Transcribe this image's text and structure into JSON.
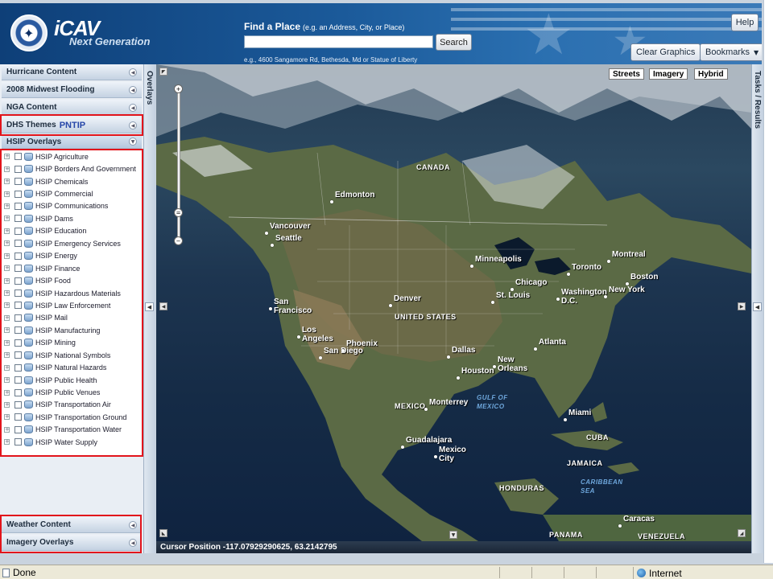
{
  "header": {
    "brand_title": "iCAV",
    "brand_subtitle": "Next Generation",
    "find_label": "Find a Place",
    "find_hint": "(e.g. an Address, City, or Place)",
    "search_value": "",
    "search_button": "Search",
    "search_example": "e.g., 4600 Sangamore Rd, Bethesda, Md or Statue of Liberty",
    "help_button": "Help",
    "clear_button": "Clear Graphics",
    "bookmarks_button": "Bookmarks"
  },
  "left_panel": {
    "sections_top": [
      {
        "label": "Hurricane Content"
      },
      {
        "label": "2008 Midwest Flooding"
      },
      {
        "label": "NGA Content"
      }
    ],
    "dhs_label": "DHS Themes",
    "dhs_tag": "PNTIP",
    "hsip_label": "HSIP Overlays",
    "overlay_items": [
      "HSIP Agriculture",
      "HSIP Borders And Government",
      "HSIP Chemicals",
      "HSIP Commercial",
      "HSIP Communications",
      "HSIP Dams",
      "HSIP Education",
      "HSIP Emergency Services",
      "HSIP Energy",
      "HSIP Finance",
      "HSIP Food",
      "HSIP Hazardous Materials",
      "HSIP Law Enforcement",
      "HSIP Mail",
      "HSIP Manufacturing",
      "HSIP Mining",
      "HSIP National Symbols",
      "HSIP Natural Hazards",
      "HSIP Public Health",
      "HSIP Public Venues",
      "HSIP Transportation Air",
      "HSIP Transportation Ground",
      "HSIP Transportation Water",
      "HSIP Water Supply"
    ],
    "sections_bottom": [
      {
        "label": "Weather Content"
      },
      {
        "label": "Imagery Overlays"
      }
    ]
  },
  "tabs": {
    "overlays": "Overlays",
    "tasks": "Tasks / Results"
  },
  "map": {
    "type_buttons": [
      "Streets",
      "Imagery",
      "Hybrid"
    ],
    "labels": [
      {
        "text": "CANADA",
        "kind": "country"
      },
      {
        "text": "Edmonton",
        "kind": "city"
      },
      {
        "text": "Vancouver",
        "kind": "city"
      },
      {
        "text": "Seattle",
        "kind": "city"
      },
      {
        "text": "Minneapolis",
        "kind": "city"
      },
      {
        "text": "Toronto",
        "kind": "city"
      },
      {
        "text": "Montreal",
        "kind": "city"
      },
      {
        "text": "Chicago",
        "kind": "city"
      },
      {
        "text": "Boston",
        "kind": "city"
      },
      {
        "text": "New York",
        "kind": "city"
      },
      {
        "text": "Washington D.C.",
        "kind": "city"
      },
      {
        "text": "Denver",
        "kind": "city"
      },
      {
        "text": "UNITED STATES",
        "kind": "country"
      },
      {
        "text": "St. Louis",
        "kind": "city"
      },
      {
        "text": "San Francisco",
        "kind": "city"
      },
      {
        "text": "Los Angeles",
        "kind": "city"
      },
      {
        "text": "San Diego",
        "kind": "city"
      },
      {
        "text": "Phoenix",
        "kind": "city"
      },
      {
        "text": "Dallas",
        "kind": "city"
      },
      {
        "text": "Atlanta",
        "kind": "city"
      },
      {
        "text": "Houston",
        "kind": "city"
      },
      {
        "text": "New Orleans",
        "kind": "city"
      },
      {
        "text": "GULF OF MEXICO",
        "kind": "water"
      },
      {
        "text": "Miami",
        "kind": "city"
      },
      {
        "text": "MEXICO",
        "kind": "country"
      },
      {
        "text": "Monterrey",
        "kind": "city"
      },
      {
        "text": "Guadalajara",
        "kind": "city"
      },
      {
        "text": "Mexico City",
        "kind": "city"
      },
      {
        "text": "CUBA",
        "kind": "country"
      },
      {
        "text": "JAMAICA",
        "kind": "country"
      },
      {
        "text": "CARIBBEAN SEA",
        "kind": "water"
      },
      {
        "text": "HONDURAS",
        "kind": "country"
      },
      {
        "text": "PANAMA",
        "kind": "country"
      },
      {
        "text": "Caracas",
        "kind": "city"
      },
      {
        "text": "VENEZUELA",
        "kind": "country"
      }
    ],
    "cursor_position": "Cursor Position  -117.07929290625, 63.2142795"
  },
  "status_bar": {
    "left": "Done",
    "zone": "Internet"
  },
  "colors": {
    "header_blue": "#1b5a9a",
    "highlight_red": "#e2141b",
    "map_ocean": "#1d3550"
  }
}
